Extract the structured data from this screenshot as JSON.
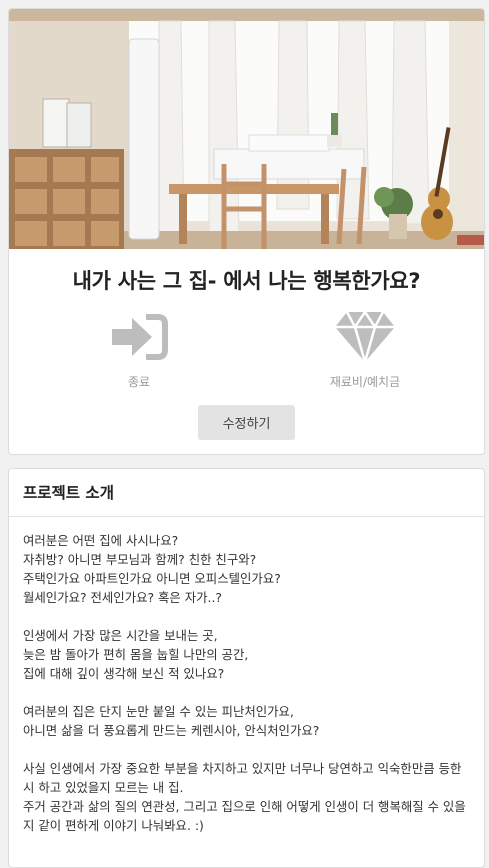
{
  "project": {
    "title": "내가 사는 그 집- 에서 나는 행복한가요?",
    "stats": [
      {
        "icon": "sign-in-arrow-icon",
        "label": "종료"
      },
      {
        "icon": "diamond-icon",
        "label": "재료비/예치금"
      }
    ],
    "edit_button": "수정하기"
  },
  "intro": {
    "heading": "프로젝트 소개",
    "paragraphs": [
      "여러분은 어떤 집에 사시나요?\n자취방? 아니면 부모님과 함께? 친한 친구와?\n주택인가요 아파트인가요 아니면 오피스텔인가요?\n월세인가요? 전세인가요? 혹은 자가..?",
      "인생에서 가장 많은 시간을 보내는 곳,\n늦은 밤 돌아가 편히 몸을 눕힐 나만의 공간,\n집에 대해 깊이 생각해 보신 적 있나요?",
      "여러분의 집은 단지 눈만 붙일 수 있는 피난처인가요,\n아니면 삶을 더 풍요롭게 만드는 케렌시아, 안식처인가요?",
      "사실 인생에서 가장 중요한 부분을 차지하고 있지만 너무나 당연하고 익숙한만큼 등한시 하고 있었을지 모르는 내 집.\n주거 공간과 삶의 질의 연관성, 그리고 집으로 인해 어떻게 인생이 더 행복해질 수 있을지 같이 편하게 이야기 나눠봐요. :)"
    ]
  },
  "colors": {
    "icon_gray": "#bdbdbd",
    "button_bg": "#e3e3e3"
  }
}
